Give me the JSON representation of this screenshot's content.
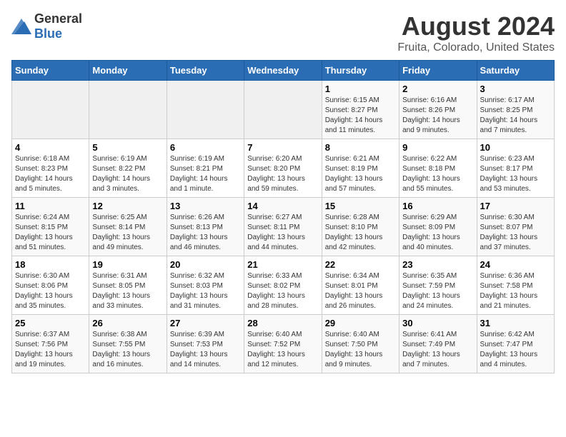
{
  "header": {
    "logo_general": "General",
    "logo_blue": "Blue",
    "title": "August 2024",
    "subtitle": "Fruita, Colorado, United States"
  },
  "weekdays": [
    "Sunday",
    "Monday",
    "Tuesday",
    "Wednesday",
    "Thursday",
    "Friday",
    "Saturday"
  ],
  "weeks": [
    [
      {
        "day": "",
        "info": ""
      },
      {
        "day": "",
        "info": ""
      },
      {
        "day": "",
        "info": ""
      },
      {
        "day": "",
        "info": ""
      },
      {
        "day": "1",
        "info": "Sunrise: 6:15 AM\nSunset: 8:27 PM\nDaylight: 14 hours and 11 minutes."
      },
      {
        "day": "2",
        "info": "Sunrise: 6:16 AM\nSunset: 8:26 PM\nDaylight: 14 hours and 9 minutes."
      },
      {
        "day": "3",
        "info": "Sunrise: 6:17 AM\nSunset: 8:25 PM\nDaylight: 14 hours and 7 minutes."
      }
    ],
    [
      {
        "day": "4",
        "info": "Sunrise: 6:18 AM\nSunset: 8:23 PM\nDaylight: 14 hours and 5 minutes."
      },
      {
        "day": "5",
        "info": "Sunrise: 6:19 AM\nSunset: 8:22 PM\nDaylight: 14 hours and 3 minutes."
      },
      {
        "day": "6",
        "info": "Sunrise: 6:19 AM\nSunset: 8:21 PM\nDaylight: 14 hours and 1 minute."
      },
      {
        "day": "7",
        "info": "Sunrise: 6:20 AM\nSunset: 8:20 PM\nDaylight: 13 hours and 59 minutes."
      },
      {
        "day": "8",
        "info": "Sunrise: 6:21 AM\nSunset: 8:19 PM\nDaylight: 13 hours and 57 minutes."
      },
      {
        "day": "9",
        "info": "Sunrise: 6:22 AM\nSunset: 8:18 PM\nDaylight: 13 hours and 55 minutes."
      },
      {
        "day": "10",
        "info": "Sunrise: 6:23 AM\nSunset: 8:17 PM\nDaylight: 13 hours and 53 minutes."
      }
    ],
    [
      {
        "day": "11",
        "info": "Sunrise: 6:24 AM\nSunset: 8:15 PM\nDaylight: 13 hours and 51 minutes."
      },
      {
        "day": "12",
        "info": "Sunrise: 6:25 AM\nSunset: 8:14 PM\nDaylight: 13 hours and 49 minutes."
      },
      {
        "day": "13",
        "info": "Sunrise: 6:26 AM\nSunset: 8:13 PM\nDaylight: 13 hours and 46 minutes."
      },
      {
        "day": "14",
        "info": "Sunrise: 6:27 AM\nSunset: 8:11 PM\nDaylight: 13 hours and 44 minutes."
      },
      {
        "day": "15",
        "info": "Sunrise: 6:28 AM\nSunset: 8:10 PM\nDaylight: 13 hours and 42 minutes."
      },
      {
        "day": "16",
        "info": "Sunrise: 6:29 AM\nSunset: 8:09 PM\nDaylight: 13 hours and 40 minutes."
      },
      {
        "day": "17",
        "info": "Sunrise: 6:30 AM\nSunset: 8:07 PM\nDaylight: 13 hours and 37 minutes."
      }
    ],
    [
      {
        "day": "18",
        "info": "Sunrise: 6:30 AM\nSunset: 8:06 PM\nDaylight: 13 hours and 35 minutes."
      },
      {
        "day": "19",
        "info": "Sunrise: 6:31 AM\nSunset: 8:05 PM\nDaylight: 13 hours and 33 minutes."
      },
      {
        "day": "20",
        "info": "Sunrise: 6:32 AM\nSunset: 8:03 PM\nDaylight: 13 hours and 31 minutes."
      },
      {
        "day": "21",
        "info": "Sunrise: 6:33 AM\nSunset: 8:02 PM\nDaylight: 13 hours and 28 minutes."
      },
      {
        "day": "22",
        "info": "Sunrise: 6:34 AM\nSunset: 8:01 PM\nDaylight: 13 hours and 26 minutes."
      },
      {
        "day": "23",
        "info": "Sunrise: 6:35 AM\nSunset: 7:59 PM\nDaylight: 13 hours and 24 minutes."
      },
      {
        "day": "24",
        "info": "Sunrise: 6:36 AM\nSunset: 7:58 PM\nDaylight: 13 hours and 21 minutes."
      }
    ],
    [
      {
        "day": "25",
        "info": "Sunrise: 6:37 AM\nSunset: 7:56 PM\nDaylight: 13 hours and 19 minutes."
      },
      {
        "day": "26",
        "info": "Sunrise: 6:38 AM\nSunset: 7:55 PM\nDaylight: 13 hours and 16 minutes."
      },
      {
        "day": "27",
        "info": "Sunrise: 6:39 AM\nSunset: 7:53 PM\nDaylight: 13 hours and 14 minutes."
      },
      {
        "day": "28",
        "info": "Sunrise: 6:40 AM\nSunset: 7:52 PM\nDaylight: 13 hours and 12 minutes."
      },
      {
        "day": "29",
        "info": "Sunrise: 6:40 AM\nSunset: 7:50 PM\nDaylight: 13 hours and 9 minutes."
      },
      {
        "day": "30",
        "info": "Sunrise: 6:41 AM\nSunset: 7:49 PM\nDaylight: 13 hours and 7 minutes."
      },
      {
        "day": "31",
        "info": "Sunrise: 6:42 AM\nSunset: 7:47 PM\nDaylight: 13 hours and 4 minutes."
      }
    ]
  ]
}
